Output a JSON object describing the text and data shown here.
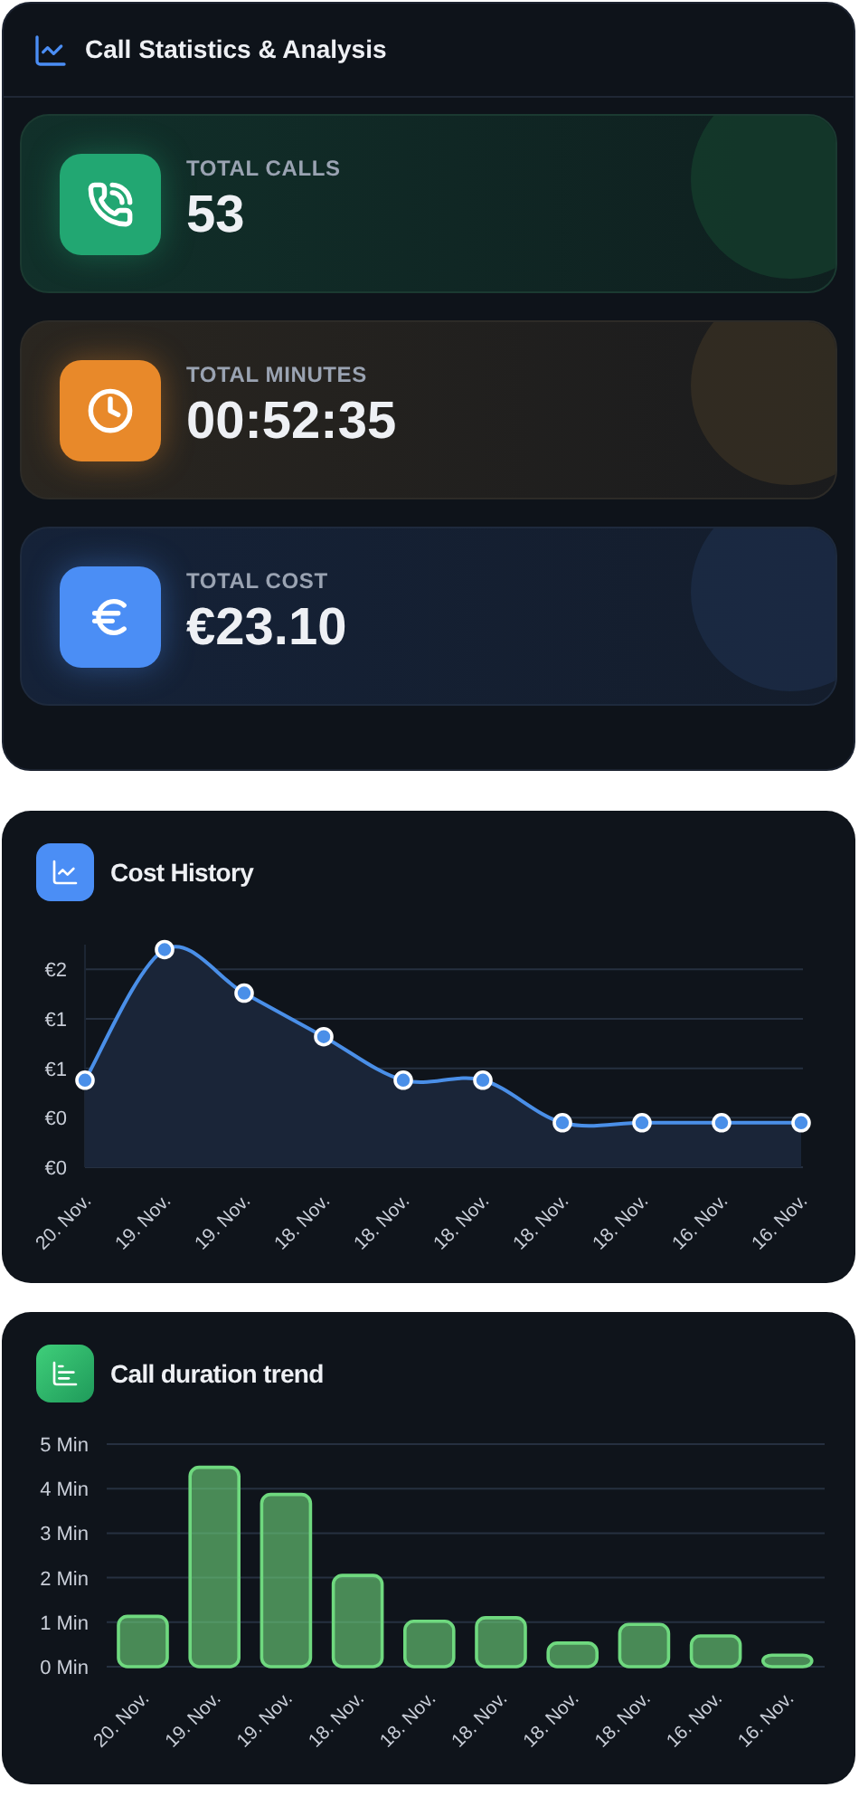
{
  "stats_panel": {
    "title": "Call Statistics & Analysis",
    "stats": [
      {
        "kind": "calls",
        "color": "#22a772",
        "label": "TOTAL CALLS",
        "value": "53"
      },
      {
        "kind": "minutes",
        "color": "#e8892a",
        "label": "TOTAL MINUTES",
        "value": "00:52:35"
      },
      {
        "kind": "cost",
        "color": "#4b8ef5",
        "label": "TOTAL COST",
        "value": "€23.10"
      }
    ]
  },
  "cost_history": {
    "title": "Cost History",
    "chart_data": {
      "type": "area",
      "categories": [
        "20. Nov.",
        "19. Nov.",
        "19. Nov.",
        "18. Nov.",
        "18. Nov.",
        "18. Nov.",
        "18. Nov.",
        "18. Nov.",
        "16. Nov.",
        "16. Nov."
      ],
      "series": [
        {
          "color": "#4a8fe8",
          "values": [
            0.88,
            2.2,
            1.76,
            1.32,
            0.88,
            0.88,
            0.45,
            0.45,
            0.45,
            0.45
          ]
        }
      ],
      "grid": true,
      "ylim": [
        0,
        2.25
      ],
      "yticks": [
        {
          "value": 0,
          "label": "€0"
        },
        {
          "value": 0.5,
          "label": "€0"
        },
        {
          "value": 1,
          "label": "€1"
        },
        {
          "value": 1.5,
          "label": "€1"
        },
        {
          "value": 2,
          "label": "€2"
        }
      ]
    }
  },
  "duration_trend": {
    "title": "Call duration trend",
    "chart_data": {
      "type": "bar",
      "categories": [
        "20. Nov.",
        "19. Nov.",
        "19. Nov.",
        "18. Nov.",
        "18. Nov.",
        "18. Nov.",
        "18. Nov.",
        "18. Nov.",
        "16. Nov.",
        "16. Nov."
      ],
      "series": [
        {
          "color": "#6fd97f",
          "values": [
            1.13,
            4.48,
            3.87,
            2.05,
            1.02,
            1.1,
            0.53,
            0.95,
            0.69,
            0.26
          ]
        }
      ],
      "grid": true,
      "ylim": [
        0,
        5
      ],
      "yticks": [
        {
          "value": 0,
          "label": "0 Min"
        },
        {
          "value": 1,
          "label": "1 Min"
        },
        {
          "value": 2,
          "label": "2 Min"
        },
        {
          "value": 3,
          "label": "3 Min"
        },
        {
          "value": 4,
          "label": "4 Min"
        },
        {
          "value": 5,
          "label": "5 Min"
        }
      ]
    }
  }
}
